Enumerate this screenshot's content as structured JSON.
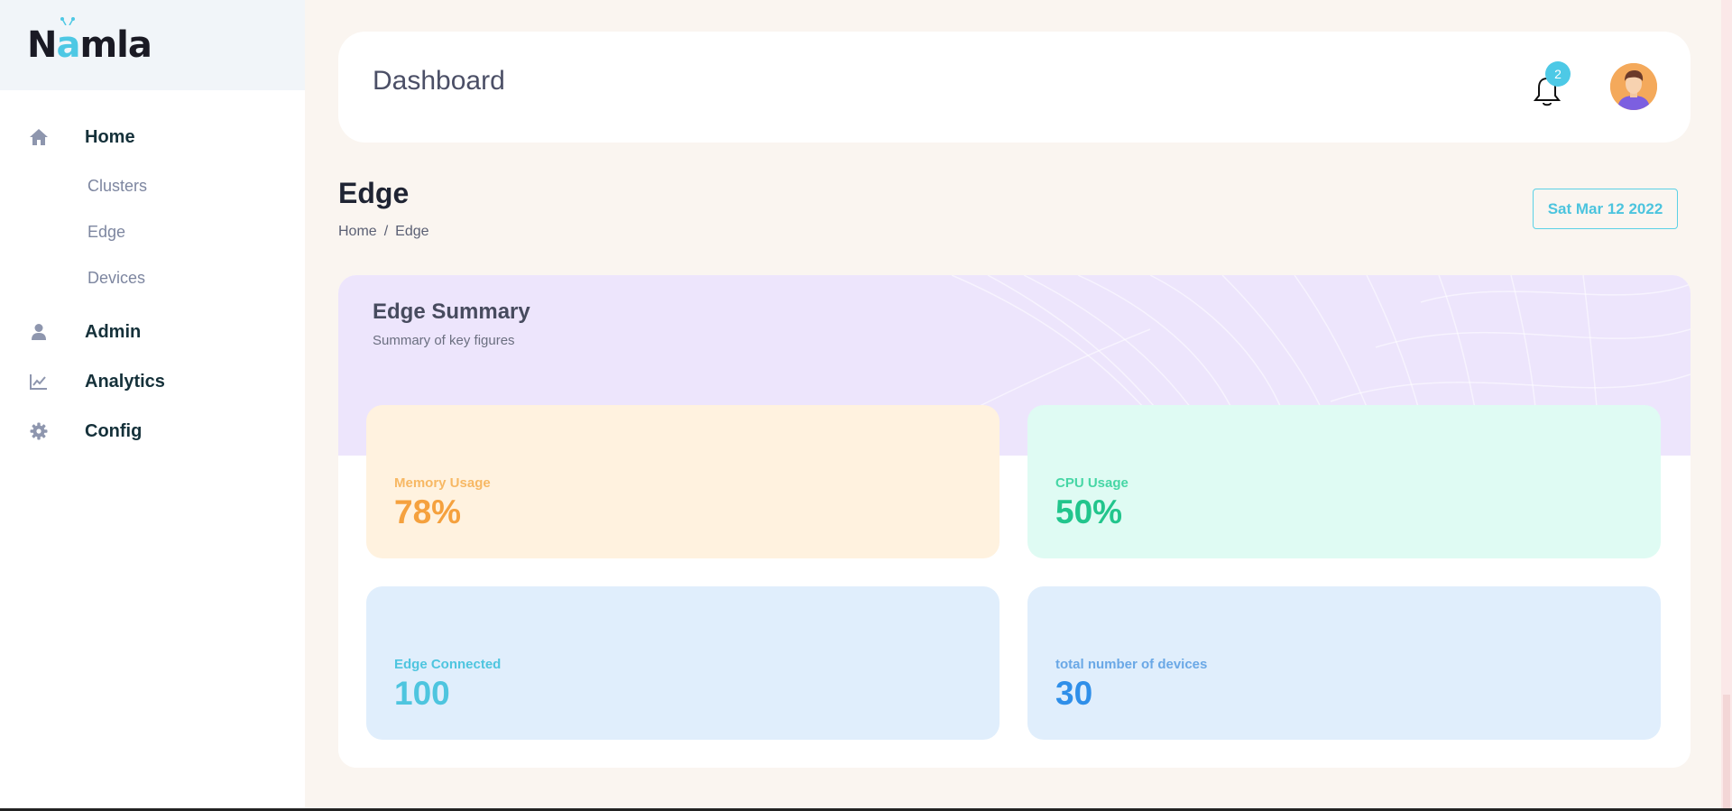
{
  "app": {
    "logo_text_1": "N",
    "logo_text_2": "a",
    "logo_text_3": "mla"
  },
  "sidebar": {
    "items": [
      {
        "label": "Home",
        "icon": "home-icon"
      },
      {
        "label": "Admin",
        "icon": "user-icon"
      },
      {
        "label": "Analytics",
        "icon": "chart-line-icon"
      },
      {
        "label": "Config",
        "icon": "gear-icon"
      }
    ],
    "subitems": [
      {
        "label": "Clusters"
      },
      {
        "label": "Edge"
      },
      {
        "label": "Devices"
      }
    ]
  },
  "header": {
    "title": "Dashboard",
    "notifications_count": "2"
  },
  "page": {
    "title": "Edge",
    "breadcrumb": [
      "Home",
      "/",
      "Edge"
    ],
    "date": "Sat Mar 12 2022"
  },
  "summary": {
    "title": "Edge Summary",
    "subtitle": "Summary of key figures",
    "stats": [
      {
        "label": "Memory Usage",
        "value": "78%"
      },
      {
        "label": "CPU Usage",
        "value": "50%"
      },
      {
        "label": "Edge Connected",
        "value": "100"
      },
      {
        "label": "total number of devices",
        "value": "30"
      }
    ]
  },
  "colors": {
    "accent": "#4dc9e6",
    "memory": "#f5a13e",
    "cpu": "#22c58c",
    "edge": "#4ec5df",
    "devices": "#2f8fe9"
  }
}
